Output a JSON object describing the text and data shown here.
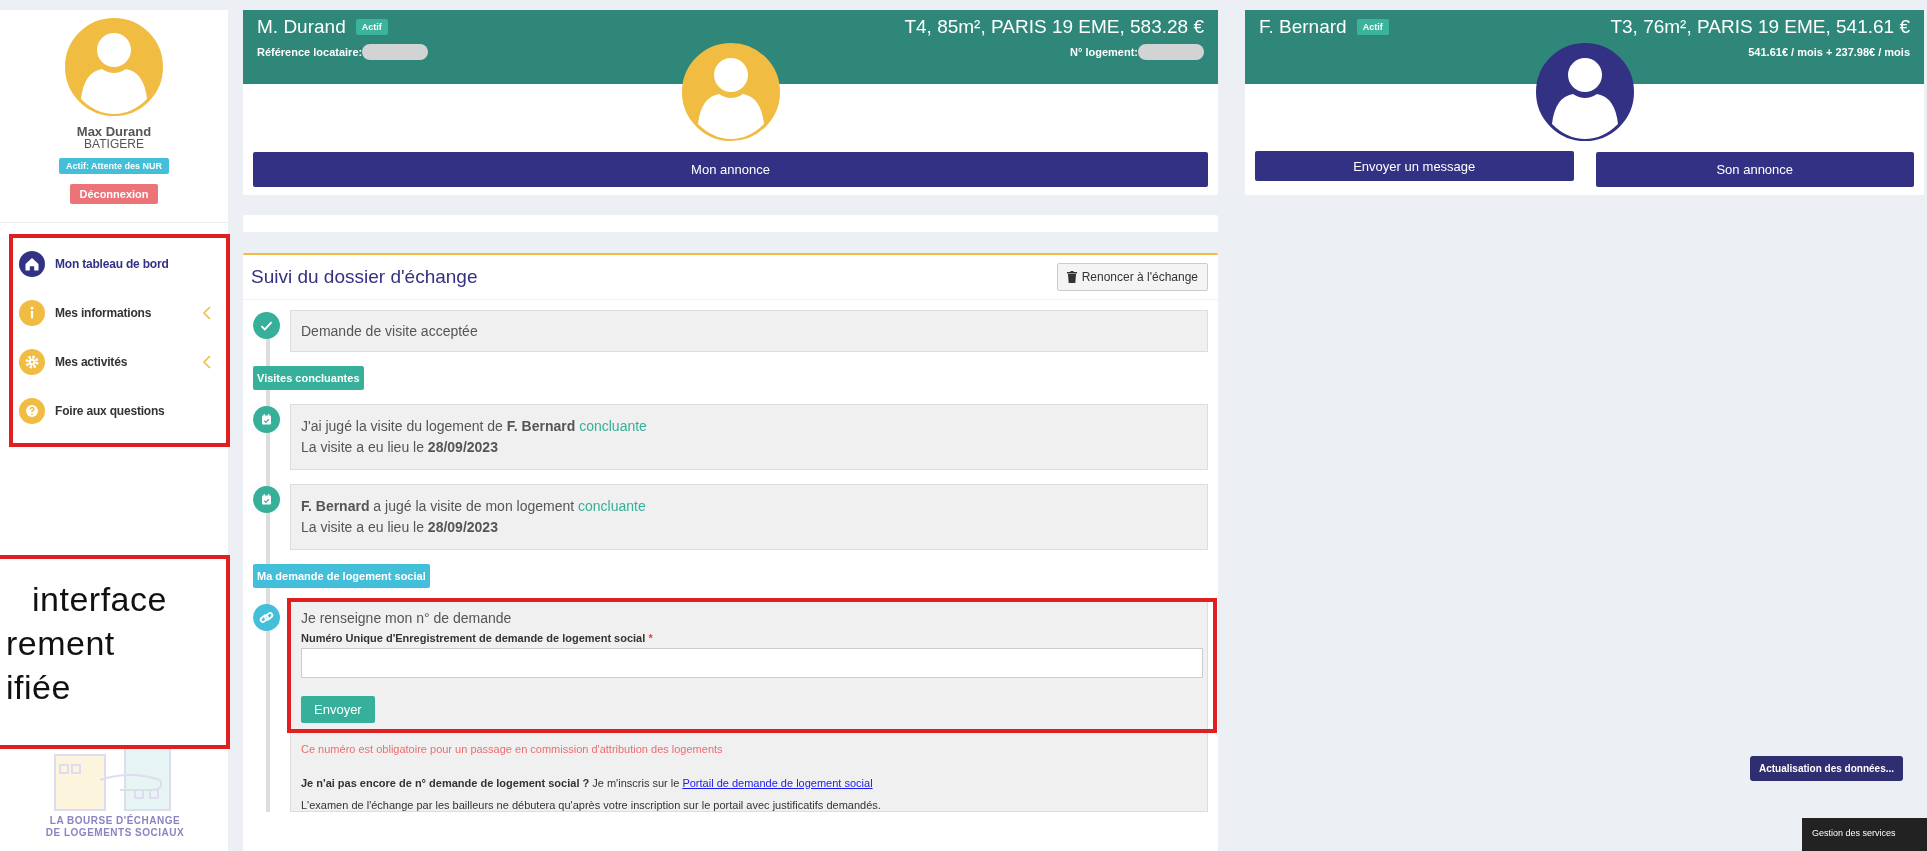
{
  "sidebar": {
    "user_name": "Max Durand",
    "organization": "BATIGERE",
    "status_badge": "Actif: Attente des NUR",
    "logout_button": "Déconnexion",
    "nav_items": [
      {
        "label": "Mon tableau de bord",
        "selected": true,
        "has_submenu": false
      },
      {
        "label": "Mes informations",
        "selected": false,
        "has_submenu": true
      },
      {
        "label": "Mes activités",
        "selected": false,
        "has_submenu": true
      },
      {
        "label": "Foire aux questions",
        "selected": false,
        "has_submenu": false
      }
    ],
    "logo_text": [
      "LA BOURSE D'ÉCHANGE",
      "DE LOGEMENTS SOCIAUX"
    ]
  },
  "callout": {
    "lines": [
      "interface",
      "rement",
      "ifiée"
    ]
  },
  "my_card": {
    "name": "M. Durand",
    "status": "Actif",
    "summary": "T4, 85m², PARIS 19 EME, 583.28 €",
    "left_label": "Référence locataire:",
    "right_label": "N° logement:",
    "buttons": [
      "Mon annonce"
    ]
  },
  "partner_card": {
    "name": "F. Bernard",
    "status": "Actif",
    "summary": "T3, 76m², PARIS 19 EME, 541.61 €",
    "rent": "541.61€ / mois + 237.98€ / mois",
    "buttons": [
      "Envoyer un message",
      "Son annonce"
    ]
  },
  "exchange_tracking": {
    "title": "Suivi du dossier d'échange",
    "action_button": "Renoncer à l'échange",
    "items": [
      {
        "kind": "status",
        "text": "Demande de visite acceptée"
      },
      {
        "kind": "section",
        "label": "Visites concluantes",
        "color": "#36b09a"
      },
      {
        "kind": "visit",
        "text": "J'ai jugé la visite du logement de **F. Bernard**",
        "result": "concluante",
        "date_line": "La visite a eu lieu le **28/09/2023**"
      },
      {
        "kind": "visit",
        "text": "**F. Bernard** a jugé la visite de mon logement",
        "result": "concluante",
        "date_line": "La visite a eu lieu le **28/09/2023**"
      },
      {
        "kind": "section",
        "label": "Ma demande de logement social",
        "color": "#44bfd9"
      },
      {
        "kind": "form",
        "title": "Je renseigne mon n° de demande",
        "field_label": "Numéro Unique d'Enregistrement de demande de logement social",
        "required_mark": "*",
        "submit": "Envoyer",
        "warning": "Ce numéro est obligatoire pour un passage en commission d'attribution des logements",
        "info": "**Je n'ai pas encore de n° demande de logement social ?** Je m'inscris sur le",
        "link": "Portail de demande de logement social",
        "note": "L'examen de l'échange par les bailleurs ne débutera qu'après votre inscription sur le portail avec justificatifs demandés."
      }
    ]
  },
  "refresh_button": "Actualisation des données...",
  "services_panel": "Gestion des services"
}
